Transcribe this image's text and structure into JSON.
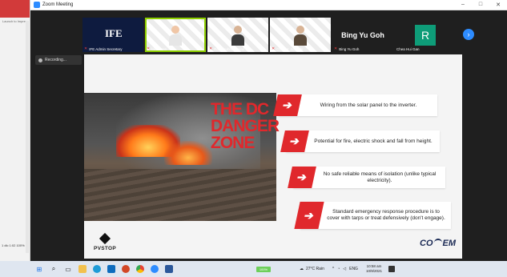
{
  "left_app": {
    "tab_text": "Launch to Impre",
    "footer": "1 dlc   1:02\n100%"
  },
  "window": {
    "title": "Zoom Meeting",
    "controls": [
      "–",
      "□",
      "✕"
    ]
  },
  "gallery": [
    {
      "name": "IFE Admin Secretary",
      "kind": "logo",
      "logo_text": "IFE"
    },
    {
      "name": "lan Foran",
      "kind": "video-person"
    },
    {
      "name": "Ramasubramanian M",
      "kind": "video-pattern"
    },
    {
      "name": "CO-EM_Isabelle",
      "kind": "video-pattern-person"
    },
    {
      "name": "Bing Yu Goh",
      "kind": "text",
      "display": "Bing Yu Goh"
    },
    {
      "name": "Chea Hui Gan",
      "kind": "initial",
      "initial": "R"
    }
  ],
  "recording_label": "Recording...",
  "slide": {
    "headline": "THE DC DANGER ZONE",
    "points": [
      "Wiring from the solar panel to the inverter.",
      "Potential for fire, electric shock and fall from height.",
      "No safe reliable means of isolation (unlike typical electricity).",
      "Standard emergency response procedure is to cover with tarps or treat defensively (don't engage)."
    ],
    "logo_left": "PVSTOP",
    "logo_right_a": "CO",
    "logo_right_b": "EM"
  },
  "taskbar": {
    "battery": "100%",
    "weather": "27°C  Rain",
    "lang": "ENG",
    "time": "10:58 am",
    "date": "10/9/2021"
  }
}
